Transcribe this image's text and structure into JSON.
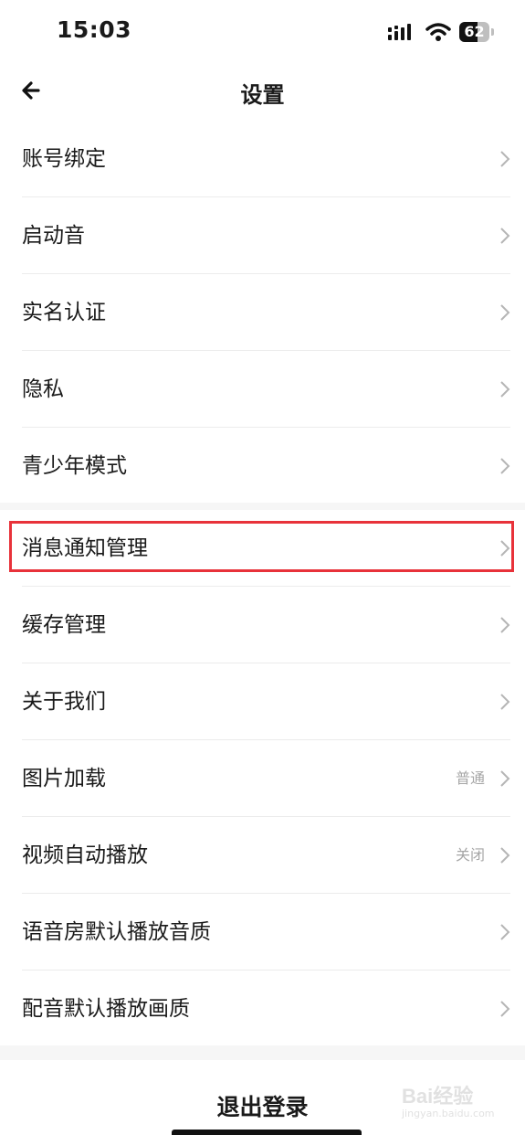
{
  "status_bar": {
    "time": "15:03",
    "battery_level": "62",
    "icons": [
      "signal-icon",
      "wifi-icon",
      "battery-icon"
    ]
  },
  "nav": {
    "title": "设置",
    "back_icon": "back-arrow-icon"
  },
  "settings_group_1": [
    {
      "label": "账号绑定",
      "value": ""
    },
    {
      "label": "启动音",
      "value": ""
    },
    {
      "label": "实名认证",
      "value": ""
    },
    {
      "label": "隐私",
      "value": ""
    },
    {
      "label": "青少年模式",
      "value": ""
    }
  ],
  "settings_group_2": [
    {
      "label": "消息通知管理",
      "value": "",
      "highlighted": true
    },
    {
      "label": "缓存管理",
      "value": ""
    },
    {
      "label": "关于我们",
      "value": ""
    },
    {
      "label": "图片加载",
      "value": "普通"
    },
    {
      "label": "视频自动播放",
      "value": "关闭"
    },
    {
      "label": "语音房默认播放音质",
      "value": ""
    },
    {
      "label": "配音默认播放画质",
      "value": ""
    }
  ],
  "logout": {
    "label": "退出登录"
  },
  "watermark": {
    "brand": "Bai经验",
    "site": "jingyan.baidu.com"
  },
  "colors": {
    "highlight": "#e8323a",
    "value_text": "#a6a6a6",
    "divider": "#ececec"
  }
}
